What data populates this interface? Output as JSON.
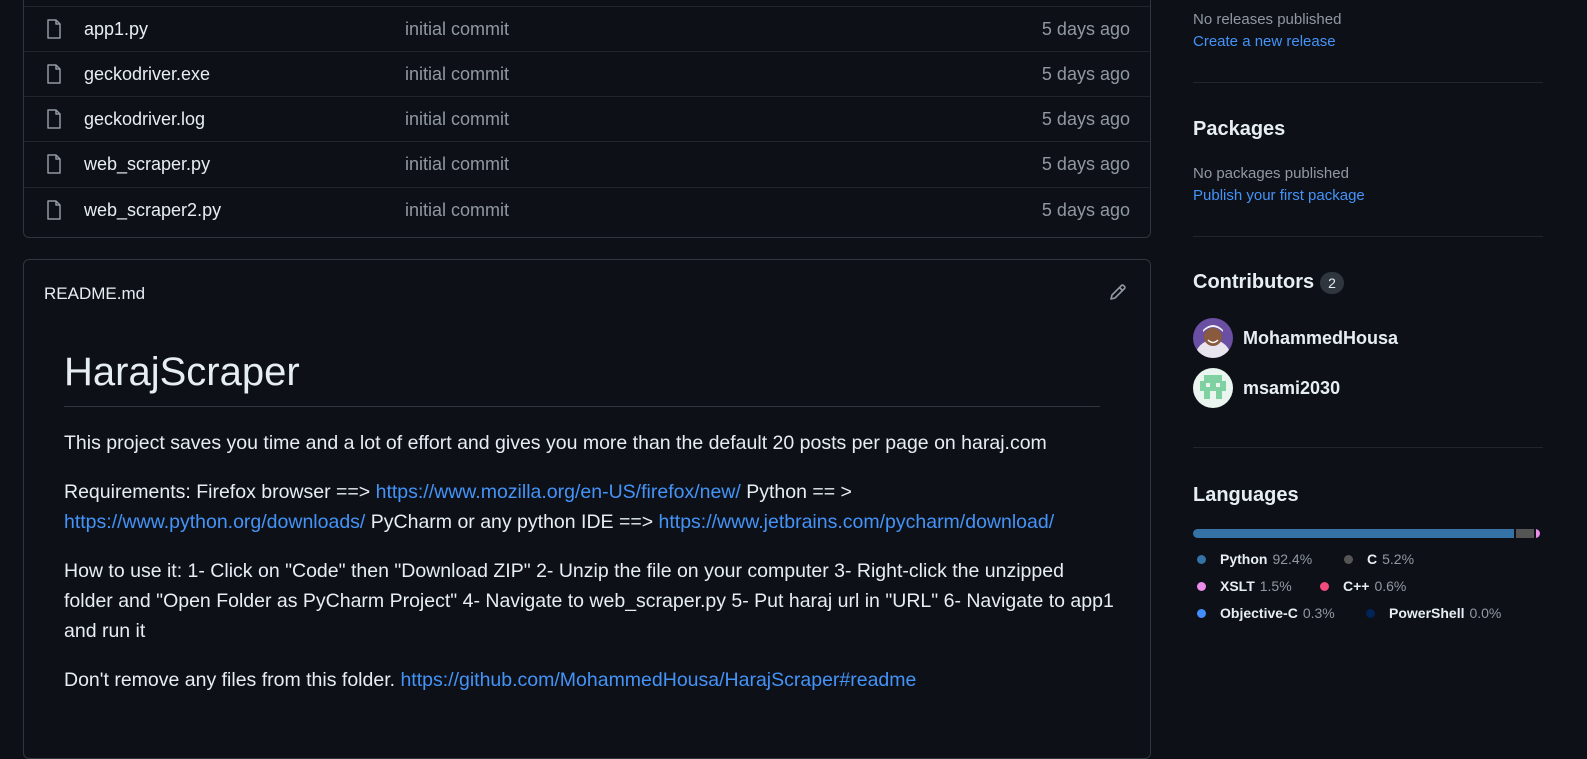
{
  "files": [
    {
      "name": "app1.py",
      "message": "initial commit",
      "age": "5 days ago"
    },
    {
      "name": "geckodriver.exe",
      "message": "initial commit",
      "age": "5 days ago"
    },
    {
      "name": "geckodriver.log",
      "message": "initial commit",
      "age": "5 days ago"
    },
    {
      "name": "web_scraper.py",
      "message": "initial commit",
      "age": "5 days ago"
    },
    {
      "name": "web_scraper2.py",
      "message": "initial commit",
      "age": "5 days ago"
    }
  ],
  "readme": {
    "filename": "README.md",
    "title": "HarajScraper",
    "p1": "This project saves you time and a lot of effort and gives you more than the default 20 posts per page on haraj.com",
    "p2": {
      "t1": "Requirements: Firefox browser ==> ",
      "l1": "https://www.mozilla.org/en-US/firefox/new/",
      "t2": " Python == > ",
      "l2": "https://www.python.org/downloads/",
      "t3": " PyCharm or any python IDE ==> ",
      "l3": "https://www.jetbrains.com/pycharm/download/"
    },
    "p3": "How to use it: 1- Click on \"Code\" then \"Download ZIP\" 2- Unzip the file on your computer 3- Right-click the unzipped folder and \"Open Folder as PyCharm Project\" 4- Navigate to web_scraper.py 5- Put haraj url in \"URL\" 6- Navigate to app1 and run it",
    "p4": {
      "t1": "Don't remove any files from this folder. ",
      "l1": "https://github.com/MohammedHousa/HarajScraper#readme"
    }
  },
  "sidebar": {
    "releases_text": "No releases published",
    "releases_link": "Create a new release",
    "packages_title": "Packages",
    "packages_text": "No packages published",
    "packages_link": "Publish your first package",
    "contributors_title": "Contributors",
    "contributors_count": "2",
    "contributors": [
      {
        "name": "MohammedHousa"
      },
      {
        "name": "msami2030"
      }
    ],
    "languages_title": "Languages",
    "languages": [
      {
        "name": "Python",
        "pct": "92.4%",
        "value": 92.4,
        "color": "#3572A5"
      },
      {
        "name": "C",
        "pct": "5.2%",
        "value": 5.2,
        "color": "#555555"
      },
      {
        "name": "XSLT",
        "pct": "1.5%",
        "value": 1.5,
        "color": "#EB8CEB"
      },
      {
        "name": "C++",
        "pct": "0.6%",
        "value": 0.6,
        "color": "#f34b7d"
      },
      {
        "name": "Objective-C",
        "pct": "0.3%",
        "value": 0.3,
        "color": "#438eff"
      },
      {
        "name": "PowerShell",
        "pct": "0.0%",
        "value": 0.0,
        "color": "#012456"
      }
    ]
  }
}
